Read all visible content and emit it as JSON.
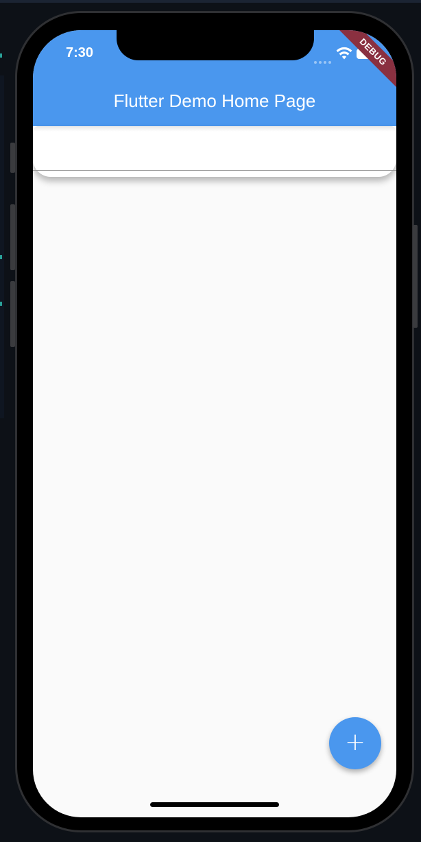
{
  "status_bar": {
    "time": "7:30",
    "icons": [
      "cellular-dots-icon",
      "wifi-icon",
      "battery-icon"
    ]
  },
  "app_bar": {
    "title": "Flutter Demo Home Page",
    "color": "#4a97ee"
  },
  "debug_banner": {
    "label": "DEBUG",
    "color": "#8a3040"
  },
  "fab": {
    "icon": "plus-icon",
    "glyph": "+",
    "color": "#4a97ee"
  },
  "colors": {
    "background": "#fafafa",
    "panel": "#ffffff"
  }
}
